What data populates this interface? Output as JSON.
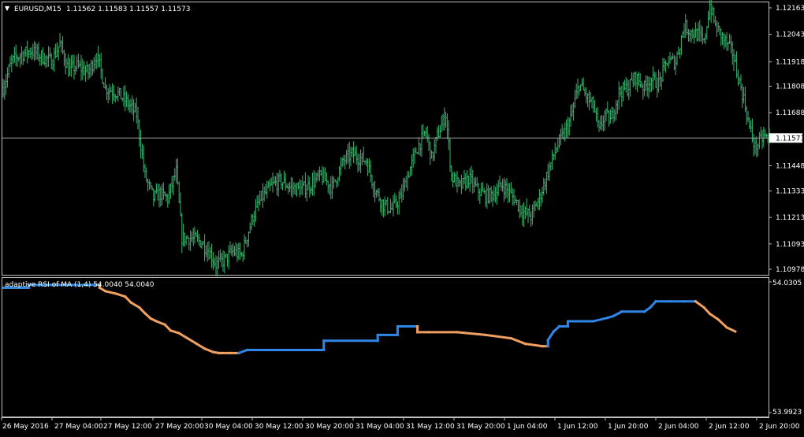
{
  "main_chart": {
    "title_arrow": "▼",
    "symbol": "EURUSD,M15",
    "quote": "1.11562 1.11583 1.11557 1.11573",
    "current_price": "1.11573",
    "price_min": 1.10978,
    "price_max": 1.12163,
    "bar_color": "#3cb371",
    "price_line_color": "#a0a0a0",
    "price_labels": [
      "1.12163",
      "1.12043",
      "1.11918",
      "1.11808",
      "1.11688",
      "1.11448",
      "1.11333",
      "1.11213",
      "1.11093",
      "1.10978"
    ]
  },
  "indicator": {
    "label": "adaptive RSI of MA (1,4) 54.0040 54.0040",
    "scale_top": "54.0305",
    "scale_bottom": "53.9923",
    "v_min": 53.9923,
    "v_max": 54.0305,
    "up_color": "#2f86e6",
    "down_color": "#f0a060"
  },
  "time_labels": [
    "26 May 2016",
    "27 May 04:00",
    "27 May 12:00",
    "27 May 20:00",
    "30 May 04:00",
    "30 May 12:00",
    "30 May 20:00",
    "31 May 04:00",
    "31 May 12:00",
    "31 May 20:00",
    "1 Jun 04:00",
    "1 Jun 12:00",
    "1 Jun 20:00",
    "2 Jun 04:00",
    "2 Jun 12:00",
    "2 Jun 20:00"
  ],
  "chart_data": [
    {
      "type": "bar",
      "subtype": "ohlc",
      "title": "EURUSD,M15",
      "ylim": [
        1.10978,
        1.12163
      ],
      "close_path": [
        [
          0,
          1.118
        ],
        [
          6,
          1.1192
        ],
        [
          12,
          1.1195
        ],
        [
          20,
          1.1197
        ],
        [
          28,
          1.1194
        ],
        [
          34,
          1.1192
        ],
        [
          40,
          1.12
        ],
        [
          46,
          1.1188
        ],
        [
          52,
          1.119
        ],
        [
          60,
          1.1187
        ],
        [
          66,
          1.1195
        ],
        [
          72,
          1.118
        ],
        [
          80,
          1.1178
        ],
        [
          88,
          1.1173
        ],
        [
          94,
          1.1168
        ],
        [
          100,
          1.114
        ],
        [
          106,
          1.113
        ],
        [
          110,
          1.1132
        ],
        [
          116,
          1.113
        ],
        [
          122,
          1.1142
        ],
        [
          126,
          1.1112
        ],
        [
          132,
          1.1112
        ],
        [
          140,
          1.111
        ],
        [
          146,
          1.1105
        ],
        [
          150,
          1.11
        ],
        [
          156,
          1.1102
        ],
        [
          162,
          1.1106
        ],
        [
          168,
          1.1104
        ],
        [
          172,
          1.1113
        ],
        [
          176,
          1.1122
        ],
        [
          182,
          1.113
        ],
        [
          190,
          1.1136
        ],
        [
          196,
          1.1138
        ],
        [
          202,
          1.1135
        ],
        [
          210,
          1.1134
        ],
        [
          216,
          1.1136
        ],
        [
          224,
          1.114
        ],
        [
          232,
          1.1135
        ],
        [
          240,
          1.1147
        ],
        [
          246,
          1.115
        ],
        [
          252,
          1.1148
        ],
        [
          256,
          1.1147
        ],
        [
          262,
          1.1134
        ],
        [
          268,
          1.1127
        ],
        [
          274,
          1.1125
        ],
        [
          280,
          1.113
        ],
        [
          286,
          1.1142
        ],
        [
          292,
          1.1153
        ],
        [
          298,
          1.116
        ],
        [
          302,
          1.1148
        ],
        [
          306,
          1.1158
        ],
        [
          312,
          1.1168
        ],
        [
          316,
          1.114
        ],
        [
          322,
          1.1135
        ],
        [
          328,
          1.1139
        ],
        [
          334,
          1.1134
        ],
        [
          340,
          1.1131
        ],
        [
          346,
          1.1132
        ],
        [
          352,
          1.1136
        ],
        [
          360,
          1.113
        ],
        [
          366,
          1.1124
        ],
        [
          372,
          1.1122
        ],
        [
          378,
          1.113
        ],
        [
          384,
          1.1142
        ],
        [
          390,
          1.1153
        ],
        [
          396,
          1.116
        ],
        [
          400,
          1.1166
        ],
        [
          406,
          1.1182
        ],
        [
          412,
          1.1175
        ],
        [
          416,
          1.1172
        ],
        [
          420,
          1.116
        ],
        [
          424,
          1.1168
        ],
        [
          428,
          1.1165
        ],
        [
          434,
          1.1178
        ],
        [
          440,
          1.118
        ],
        [
          446,
          1.1185
        ],
        [
          452,
          1.118
        ],
        [
          456,
          1.1184
        ],
        [
          462,
          1.1182
        ],
        [
          468,
          1.1192
        ],
        [
          474,
          1.1192
        ],
        [
          480,
          1.1208
        ],
        [
          486,
          1.1205
        ],
        [
          490,
          1.1204
        ],
        [
          494,
          1.12
        ],
        [
          498,
          1.1218
        ],
        [
          502,
          1.1208
        ],
        [
          508,
          1.1202
        ],
        [
          514,
          1.1196
        ],
        [
          518,
          1.1185
        ],
        [
          522,
          1.1175
        ],
        [
          526,
          1.1162
        ],
        [
          530,
          1.1153
        ],
        [
          536,
          1.1158
        ],
        [
          540,
          1.1157
        ]
      ]
    },
    {
      "type": "line",
      "title": "adaptive RSI of MA (1,4) 54.0040 54.0040",
      "ylim": [
        53.9923,
        54.0305
      ],
      "series": [
        {
          "name": "adaptive RSI of MA (1,4)",
          "values": [
            [
              0,
              54.0288
            ],
            [
              18,
              54.0288
            ],
            [
              18,
              54.0296
            ],
            [
              68,
              54.0296
            ],
            [
              68,
              54.0288
            ],
            [
              72,
              54.0278
            ],
            [
              80,
              54.027
            ],
            [
              86,
              54.0262
            ],
            [
              90,
              54.0245
            ],
            [
              96,
              54.023
            ],
            [
              100,
              54.0213
            ],
            [
              104,
              54.0198
            ],
            [
              108,
              54.019
            ],
            [
              114,
              54.018
            ],
            [
              118,
              54.0163
            ],
            [
              124,
              54.0155
            ],
            [
              130,
              54.014
            ],
            [
              136,
              54.0125
            ],
            [
              142,
              54.011
            ],
            [
              148,
              54.01
            ],
            [
              152,
              54.0097
            ],
            [
              154,
              54.0097
            ],
            [
              160,
              54.0097
            ],
            [
              166,
              54.0097
            ],
            [
              172,
              54.0106
            ],
            [
              178,
              54.0106
            ],
            [
              200,
              54.0106
            ],
            [
              226,
              54.0106
            ],
            [
              226,
              54.0133
            ],
            [
              264,
              54.0133
            ],
            [
              264,
              54.015
            ],
            [
              278,
              54.015
            ],
            [
              278,
              54.0175
            ],
            [
              282,
              54.0175
            ],
            [
              292,
              54.0175
            ],
            [
              292,
              54.0158
            ],
            [
              300,
              54.0158
            ],
            [
              320,
              54.0158
            ],
            [
              340,
              54.015
            ],
            [
              358,
              54.014
            ],
            [
              368,
              54.0124
            ],
            [
              380,
              54.0117
            ],
            [
              384,
              54.0117
            ],
            [
              384,
              54.0135
            ],
            [
              388,
              54.016
            ],
            [
              392,
              54.0175
            ],
            [
              398,
              54.0175
            ],
            [
              398,
              54.019
            ],
            [
              416,
              54.019
            ],
            [
              426,
              54.02
            ],
            [
              430,
              54.0205
            ],
            [
              436,
              54.0218
            ],
            [
              452,
              54.0218
            ],
            [
              456,
              54.023
            ],
            [
              460,
              54.0248
            ],
            [
              470,
              54.0248
            ],
            [
              480,
              54.0248
            ],
            [
              488,
              54.0248
            ],
            [
              494,
              54.023
            ],
            [
              498,
              54.0212
            ],
            [
              504,
              54.0195
            ],
            [
              510,
              54.0172
            ],
            [
              516,
              54.016
            ]
          ]
        }
      ]
    }
  ]
}
